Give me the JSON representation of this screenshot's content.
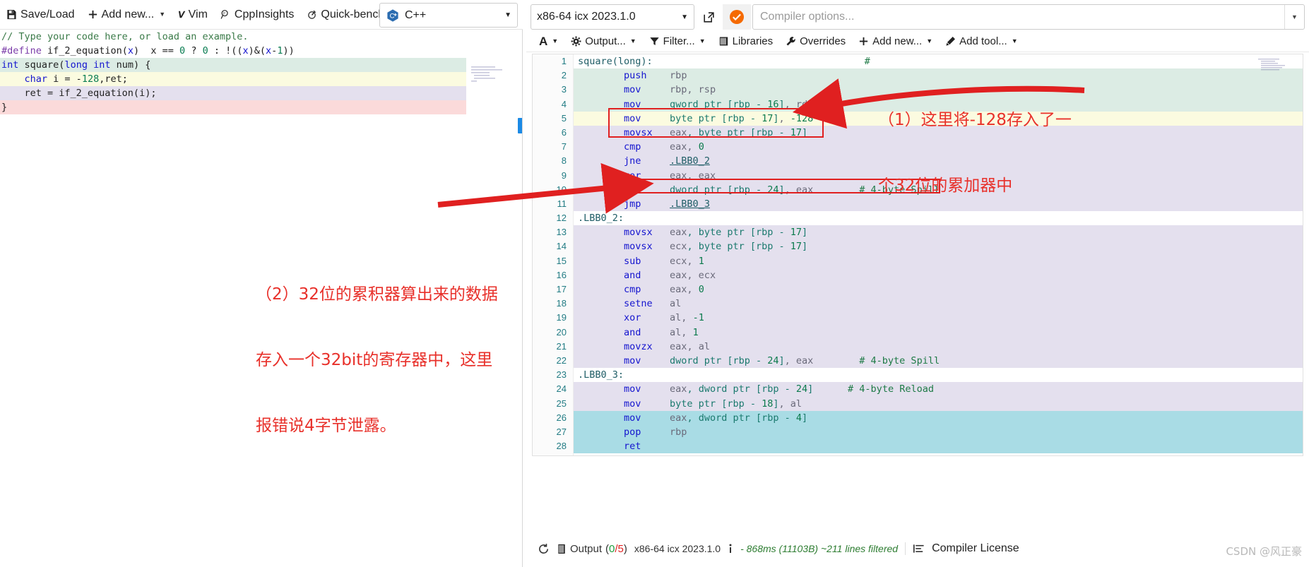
{
  "editor_toolbar": {
    "buttons": [
      {
        "label": "Save/Load",
        "icon": "save-icon",
        "caret": false
      },
      {
        "label": "Add new...",
        "icon": "plus-icon",
        "caret": true
      },
      {
        "label": "Vim",
        "icon": "vim-icon",
        "caret": false
      },
      {
        "label": "CppInsights",
        "icon": "cppinsights-icon",
        "caret": false
      },
      {
        "label": "Quick-bench",
        "icon": "quickbench-icon",
        "caret": false
      }
    ],
    "language": {
      "label": "C++",
      "icon": "cpp-logo-icon",
      "caret": "▾"
    }
  },
  "source_code": [
    {
      "hl": "none",
      "tokens": [
        {
          "c": "k-comment",
          "t": "// Type your code here, or load an example."
        }
      ]
    },
    {
      "hl": "none",
      "tokens": [
        {
          "c": "k-pre",
          "t": "#define"
        },
        {
          "c": "k-plain",
          "t": " "
        },
        {
          "c": "k-plain",
          "t": "if_2_equation"
        },
        {
          "c": "k-op",
          "t": "("
        },
        {
          "c": "k-kw",
          "t": "x"
        },
        {
          "c": "k-op",
          "t": ")"
        },
        {
          "c": "k-plain",
          "t": "  x == "
        },
        {
          "c": "k-num",
          "t": "0"
        },
        {
          "c": "k-plain",
          "t": " ? "
        },
        {
          "c": "k-num",
          "t": "0"
        },
        {
          "c": "k-plain",
          "t": " : !(("
        },
        {
          "c": "k-kw",
          "t": "x"
        },
        {
          "c": "k-plain",
          "t": ")&("
        },
        {
          "c": "k-kw",
          "t": "x"
        },
        {
          "c": "k-plain",
          "t": "-"
        },
        {
          "c": "k-num",
          "t": "1"
        },
        {
          "c": "k-plain",
          "t": "))"
        }
      ]
    },
    {
      "hl": "green",
      "tokens": [
        {
          "c": "k-type",
          "t": "int"
        },
        {
          "c": "k-plain",
          "t": " square"
        },
        {
          "c": "k-op",
          "t": "("
        },
        {
          "c": "k-type",
          "t": "long"
        },
        {
          "c": "k-plain",
          "t": " "
        },
        {
          "c": "k-type",
          "t": "int"
        },
        {
          "c": "k-plain",
          "t": " num"
        },
        {
          "c": "k-op",
          "t": ") {"
        }
      ]
    },
    {
      "hl": "yellow",
      "tokens": [
        {
          "c": "k-plain",
          "t": "    "
        },
        {
          "c": "k-type",
          "t": "char"
        },
        {
          "c": "k-plain",
          "t": " i = -"
        },
        {
          "c": "k-num",
          "t": "128"
        },
        {
          "c": "k-plain",
          "t": ",ret;"
        }
      ]
    },
    {
      "hl": "purple",
      "tokens": [
        {
          "c": "k-plain",
          "t": "    ret = if_2_equation(i);"
        }
      ]
    },
    {
      "hl": "pink",
      "tokens": [
        {
          "c": "k-plain",
          "t": "}"
        }
      ]
    }
  ],
  "compiler": {
    "name": "x86-64 icx 2023.1.0",
    "caret": "▾",
    "popout_icon": "popout-icon",
    "status_icon": "status-ok-icon",
    "options_placeholder": "Compiler options...",
    "options_value": "",
    "options_caret": "▾"
  },
  "compiler_toolbar": [
    {
      "label": "",
      "icon": "font-size-icon",
      "caret": true,
      "glyph": "A"
    },
    {
      "label": "Output...",
      "icon": "gear-icon",
      "caret": true
    },
    {
      "label": "Filter...",
      "icon": "filter-icon",
      "caret": true
    },
    {
      "label": "Libraries",
      "icon": "libraries-icon",
      "caret": false
    },
    {
      "label": "Overrides",
      "icon": "wrench-icon",
      "caret": false
    },
    {
      "label": "Add new...",
      "icon": "plus-icon",
      "caret": true
    },
    {
      "label": "Add tool...",
      "icon": "tool-icon",
      "caret": true
    }
  ],
  "asm_lines": [
    {
      "n": 1,
      "hl": "none",
      "tokens": [
        {
          "c": "sym",
          "t": "square(long):"
        }
      ],
      "trail": "#"
    },
    {
      "n": 2,
      "hl": "green",
      "tokens": [
        {
          "c": "op",
          "t": "        push"
        },
        {
          "c": "reg",
          "t": "    rbp"
        }
      ]
    },
    {
      "n": 3,
      "hl": "green",
      "tokens": [
        {
          "c": "op",
          "t": "        mov"
        },
        {
          "c": "reg",
          "t": "     rbp, rsp"
        }
      ]
    },
    {
      "n": 4,
      "hl": "green",
      "tokens": [
        {
          "c": "op",
          "t": "        mov"
        },
        {
          "c": "mem",
          "t": "     qword ptr [rbp - "
        },
        {
          "c": "numlit",
          "t": "16"
        },
        {
          "c": "mem",
          "t": "]"
        },
        {
          "c": "reg",
          "t": ", rdi"
        }
      ]
    },
    {
      "n": 5,
      "hl": "yellow",
      "tokens": [
        {
          "c": "op",
          "t": "        mov"
        },
        {
          "c": "mem",
          "t": "     byte ptr [rbp - "
        },
        {
          "c": "numlit",
          "t": "17"
        },
        {
          "c": "mem",
          "t": "]"
        },
        {
          "c": "reg",
          "t": ", "
        },
        {
          "c": "numlit",
          "t": "-128"
        }
      ]
    },
    {
      "n": 6,
      "hl": "purple",
      "tokens": [
        {
          "c": "op",
          "t": "        movsx"
        },
        {
          "c": "reg",
          "t": "   eax"
        },
        {
          "c": "mem",
          "t": ", byte ptr [rbp - "
        },
        {
          "c": "numlit",
          "t": "17"
        },
        {
          "c": "mem",
          "t": "]"
        }
      ]
    },
    {
      "n": 7,
      "hl": "purple",
      "tokens": [
        {
          "c": "op",
          "t": "        cmp"
        },
        {
          "c": "reg",
          "t": "     eax, "
        },
        {
          "c": "numlit",
          "t": "0"
        }
      ]
    },
    {
      "n": 8,
      "hl": "purple",
      "tokens": [
        {
          "c": "op",
          "t": "        jne"
        },
        {
          "c": "reg",
          "t": "     "
        },
        {
          "c": "jlink",
          "t": ".LBB0_2"
        }
      ]
    },
    {
      "n": 9,
      "hl": "purple",
      "tokens": [
        {
          "c": "op",
          "t": "        xor"
        },
        {
          "c": "reg",
          "t": "     eax, eax"
        }
      ]
    },
    {
      "n": 10,
      "hl": "purple",
      "tokens": [
        {
          "c": "op",
          "t": "        mov"
        },
        {
          "c": "mem",
          "t": "     dword ptr [rbp - "
        },
        {
          "c": "numlit",
          "t": "24"
        },
        {
          "c": "mem",
          "t": "]"
        },
        {
          "c": "reg",
          "t": ", eax"
        },
        {
          "c": "cmt",
          "t": "        # 4-byte Spill"
        }
      ]
    },
    {
      "n": 11,
      "hl": "purple",
      "tokens": [
        {
          "c": "op",
          "t": "        jmp"
        },
        {
          "c": "reg",
          "t": "     "
        },
        {
          "c": "jlink",
          "t": ".LBB0_3"
        }
      ]
    },
    {
      "n": 12,
      "hl": "none",
      "tokens": [
        {
          "c": "sym",
          "t": ".LBB0_2:"
        }
      ]
    },
    {
      "n": 13,
      "hl": "purple",
      "tokens": [
        {
          "c": "op",
          "t": "        movsx"
        },
        {
          "c": "reg",
          "t": "   eax"
        },
        {
          "c": "mem",
          "t": ", byte ptr [rbp - "
        },
        {
          "c": "numlit",
          "t": "17"
        },
        {
          "c": "mem",
          "t": "]"
        }
      ]
    },
    {
      "n": 14,
      "hl": "purple",
      "tokens": [
        {
          "c": "op",
          "t": "        movsx"
        },
        {
          "c": "reg",
          "t": "   ecx"
        },
        {
          "c": "mem",
          "t": ", byte ptr [rbp - "
        },
        {
          "c": "numlit",
          "t": "17"
        },
        {
          "c": "mem",
          "t": "]"
        }
      ]
    },
    {
      "n": 15,
      "hl": "purple",
      "tokens": [
        {
          "c": "op",
          "t": "        sub"
        },
        {
          "c": "reg",
          "t": "     ecx, "
        },
        {
          "c": "numlit",
          "t": "1"
        }
      ]
    },
    {
      "n": 16,
      "hl": "purple",
      "tokens": [
        {
          "c": "op",
          "t": "        and"
        },
        {
          "c": "reg",
          "t": "     eax, ecx"
        }
      ]
    },
    {
      "n": 17,
      "hl": "purple",
      "tokens": [
        {
          "c": "op",
          "t": "        cmp"
        },
        {
          "c": "reg",
          "t": "     eax, "
        },
        {
          "c": "numlit",
          "t": "0"
        }
      ]
    },
    {
      "n": 18,
      "hl": "purple",
      "tokens": [
        {
          "c": "op",
          "t": "        setne"
        },
        {
          "c": "reg",
          "t": "   al"
        }
      ]
    },
    {
      "n": 19,
      "hl": "purple",
      "tokens": [
        {
          "c": "op",
          "t": "        xor"
        },
        {
          "c": "reg",
          "t": "     al, "
        },
        {
          "c": "numlit",
          "t": "-1"
        }
      ]
    },
    {
      "n": 20,
      "hl": "purple",
      "tokens": [
        {
          "c": "op",
          "t": "        and"
        },
        {
          "c": "reg",
          "t": "     al, "
        },
        {
          "c": "numlit",
          "t": "1"
        }
      ]
    },
    {
      "n": 21,
      "hl": "purple",
      "tokens": [
        {
          "c": "op",
          "t": "        movzx"
        },
        {
          "c": "reg",
          "t": "   eax, al"
        }
      ]
    },
    {
      "n": 22,
      "hl": "purple",
      "tokens": [
        {
          "c": "op",
          "t": "        mov"
        },
        {
          "c": "mem",
          "t": "     dword ptr [rbp - "
        },
        {
          "c": "numlit",
          "t": "24"
        },
        {
          "c": "mem",
          "t": "]"
        },
        {
          "c": "reg",
          "t": ", eax"
        },
        {
          "c": "cmt",
          "t": "        # 4-byte Spill"
        }
      ]
    },
    {
      "n": 23,
      "hl": "none",
      "tokens": [
        {
          "c": "sym",
          "t": ".LBB0_3:"
        }
      ]
    },
    {
      "n": 24,
      "hl": "purple",
      "tokens": [
        {
          "c": "op",
          "t": "        mov"
        },
        {
          "c": "reg",
          "t": "     eax"
        },
        {
          "c": "mem",
          "t": ", dword ptr [rbp - "
        },
        {
          "c": "numlit",
          "t": "24"
        },
        {
          "c": "mem",
          "t": "]"
        },
        {
          "c": "cmt",
          "t": "      # 4-byte Reload"
        }
      ]
    },
    {
      "n": 25,
      "hl": "purple",
      "tokens": [
        {
          "c": "op",
          "t": "        mov"
        },
        {
          "c": "mem",
          "t": "     byte ptr [rbp - "
        },
        {
          "c": "numlit",
          "t": "18"
        },
        {
          "c": "mem",
          "t": "]"
        },
        {
          "c": "reg",
          "t": ", al"
        }
      ]
    },
    {
      "n": 26,
      "hl": "cyan",
      "tokens": [
        {
          "c": "op",
          "t": "        mov"
        },
        {
          "c": "reg",
          "t": "     eax"
        },
        {
          "c": "mem",
          "t": ", dword ptr [rbp - "
        },
        {
          "c": "numlit",
          "t": "4"
        },
        {
          "c": "mem",
          "t": "]"
        }
      ]
    },
    {
      "n": 27,
      "hl": "cyan",
      "tokens": [
        {
          "c": "op",
          "t": "        pop"
        },
        {
          "c": "reg",
          "t": "     rbp"
        }
      ]
    },
    {
      "n": 28,
      "hl": "cyan",
      "tokens": [
        {
          "c": "op",
          "t": "        ret"
        }
      ]
    }
  ],
  "annotations": [
    {
      "id": "annot-1",
      "line1": "（1）这里将-128存入了一",
      "line2": "个32位的累加器中"
    },
    {
      "id": "annot-2",
      "line1": "（2）32位的累积器算出来的数据",
      "line2": "存入一个32bit的寄存器中，这里",
      "line3": "报错说4字节泄露。"
    }
  ],
  "status_bar": {
    "reload_icon": "reload-icon",
    "output_icon": "output-icon",
    "output_label": "Output",
    "output_counts_open": "(",
    "output_ok": "0",
    "output_sep": "/",
    "output_total": "5",
    "output_counts_close": ")",
    "compiler_name": "x86-64 icx 2023.1.0",
    "info_icon": "info-icon",
    "timing": "- 868ms (11103B) ~211 lines filtered",
    "align_icon": "align-icon",
    "license_label": "Compiler License"
  },
  "watermark": "CSDN @风正豪",
  "colors": {
    "accent_red": "#e8302a",
    "status_orange": "#f07000",
    "link_teal": "#1f5d66",
    "opcode_blue": "#1515cf"
  }
}
